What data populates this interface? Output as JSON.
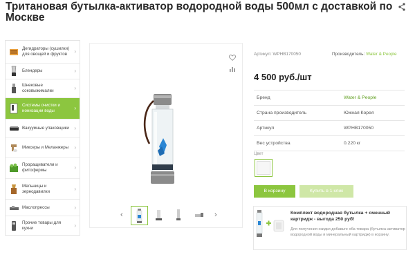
{
  "product": {
    "title": "Тритановая бутылка-активатор водородной воды 500мл с доставкой по Москве",
    "article_label": "Артикул: WPHB170050",
    "manufacturer_label": "Производитель:",
    "manufacturer_name": "Water & People",
    "price": "4 500 руб./шт"
  },
  "sidebar": {
    "items": [
      {
        "label": "Дегидраторы (сушилки) для овощей и фруктов",
        "icon": "dehydrator-icon",
        "active": false
      },
      {
        "label": "Блендеры",
        "icon": "blender-icon",
        "active": false
      },
      {
        "label": "Шнековые соковыжималки",
        "icon": "juicer-icon",
        "active": false
      },
      {
        "label": "Системы очистки и ионизации воды",
        "icon": "water-filter-icon",
        "active": true
      },
      {
        "label": "Вакуумные упаковщики",
        "icon": "vacuum-sealer-icon",
        "active": false
      },
      {
        "label": "Миксеры и Меланжеры",
        "icon": "mixer-icon",
        "active": false
      },
      {
        "label": "Проращиватели и фитофермы",
        "icon": "sprouter-icon",
        "active": false
      },
      {
        "label": "Мельницы и зернодавилки",
        "icon": "grain-mill-icon",
        "active": false
      },
      {
        "label": "Маслопрессы",
        "icon": "oil-press-icon",
        "active": false
      },
      {
        "label": "Прочие товары для кухни",
        "icon": "kitchen-misc-icon",
        "active": false
      }
    ]
  },
  "specs": [
    {
      "key": "Бренд",
      "value": "Water & People",
      "highlight": true
    },
    {
      "key": "Страна производитель",
      "value": "Южная Корея",
      "highlight": false
    },
    {
      "key": "Артикул",
      "value": "WPHB170050",
      "highlight": false
    },
    {
      "key": "Вес устройства",
      "value": "0.220 кг",
      "highlight": false
    }
  ],
  "color": {
    "label": "Цвет"
  },
  "buttons": {
    "cart": "В корзину",
    "one_click": "Купить в 1 клик"
  },
  "combo": {
    "title": "Комплект водородная бутылка + сменный картридж - выгода 250 руб!",
    "description": "Для получения скидки добавьте оба товара (бутылка-активатор водородной воды и минеральный картридж) в корзину."
  },
  "colors": {
    "accent": "#8cc63f",
    "accent_light": "#cfe7a7"
  },
  "icons": {
    "share": "share-icon",
    "favorite": "heart-icon",
    "compare": "compare-icon",
    "prev": "chevron-left-icon",
    "next": "chevron-right-icon"
  }
}
